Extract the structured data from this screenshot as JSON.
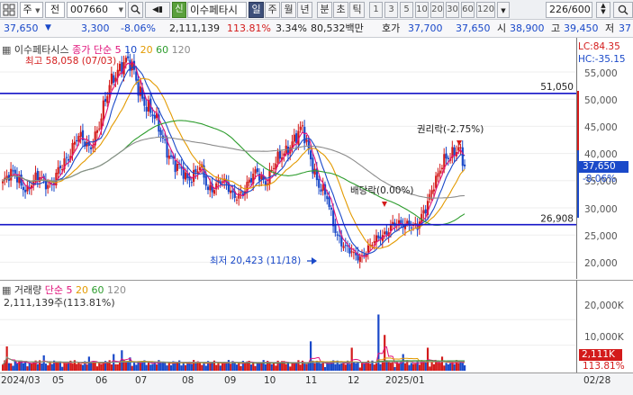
{
  "toolbar": {
    "market_type": "주",
    "chart_kind": "전",
    "stock_code": "007660",
    "stock_name": "이수페타시",
    "credit_badge": "신",
    "periods": [
      "일",
      "주",
      "월",
      "년",
      "분",
      "초",
      "틱"
    ],
    "active_period": "일",
    "intervals": [
      "1",
      "3",
      "5",
      "10",
      "20",
      "30",
      "60",
      "120"
    ],
    "candle_count": "226",
    "candle_total": "/600"
  },
  "quote": {
    "price": "37,650",
    "change": "3,300",
    "change_pct": "-8.06%",
    "volume": "2,111,139",
    "volume_ratio": "113.81%",
    "turnover": "3.34%",
    "trade_value": "80,532백만",
    "ask_label": "호가",
    "ask1": "37,700",
    "bid1": "37,650",
    "open_label": "시",
    "open": "38,900",
    "high_label": "고",
    "high": "39,450",
    "low_label": "저",
    "low": "37"
  },
  "price_pane": {
    "legend_name": "이수페타시스",
    "legend_ma_label": "종가 단순",
    "ma_periods": [
      "5",
      "10",
      "20",
      "60",
      "120"
    ],
    "ma_colors": [
      "#e0127a",
      "#1a49c9",
      "#e39a00",
      "#2e9d2e",
      "#8c8c8c"
    ],
    "lc": "LC:84.35",
    "hc": "HC:-35.15",
    "price_tag": "37,650",
    "change_tag": "-8.06%",
    "hline_upper": "51,050",
    "hline_lower": "26,908",
    "high_annotation": "최고 58,058 (07/03)",
    "low_annotation": "최저 20,423 (11/18)",
    "dividend_annotation": "배당락(0.00%)",
    "rights_annotation": "권리락(-2.75%)",
    "yticks": [
      "55,000",
      "50,000",
      "45,000",
      "40,000",
      "35,000",
      "30,000",
      "25,000",
      "20,000"
    ]
  },
  "volume_pane": {
    "legend_name": "거래량",
    "legend_ma_label": "단순",
    "ma_periods": [
      "5",
      "20",
      "60",
      "120"
    ],
    "ma_colors": [
      "#e0127a",
      "#e39a00",
      "#2e9d2e",
      "#8c8c8c"
    ],
    "volume_text": "2,111,139주(113.81%)",
    "yticks": [
      "20,000K",
      "10,000K"
    ],
    "vol_tag": "2,111K",
    "vol_pct_tag": "113.81%"
  },
  "xaxis": {
    "labels": [
      "2024/03",
      "05",
      "06",
      "07",
      "08",
      "09",
      "10",
      "11",
      "12",
      "2025/01",
      "02/28"
    ]
  },
  "colors": {
    "up": "#d31b1b",
    "down": "#1a49c9",
    "hline": "#1515c8"
  }
}
